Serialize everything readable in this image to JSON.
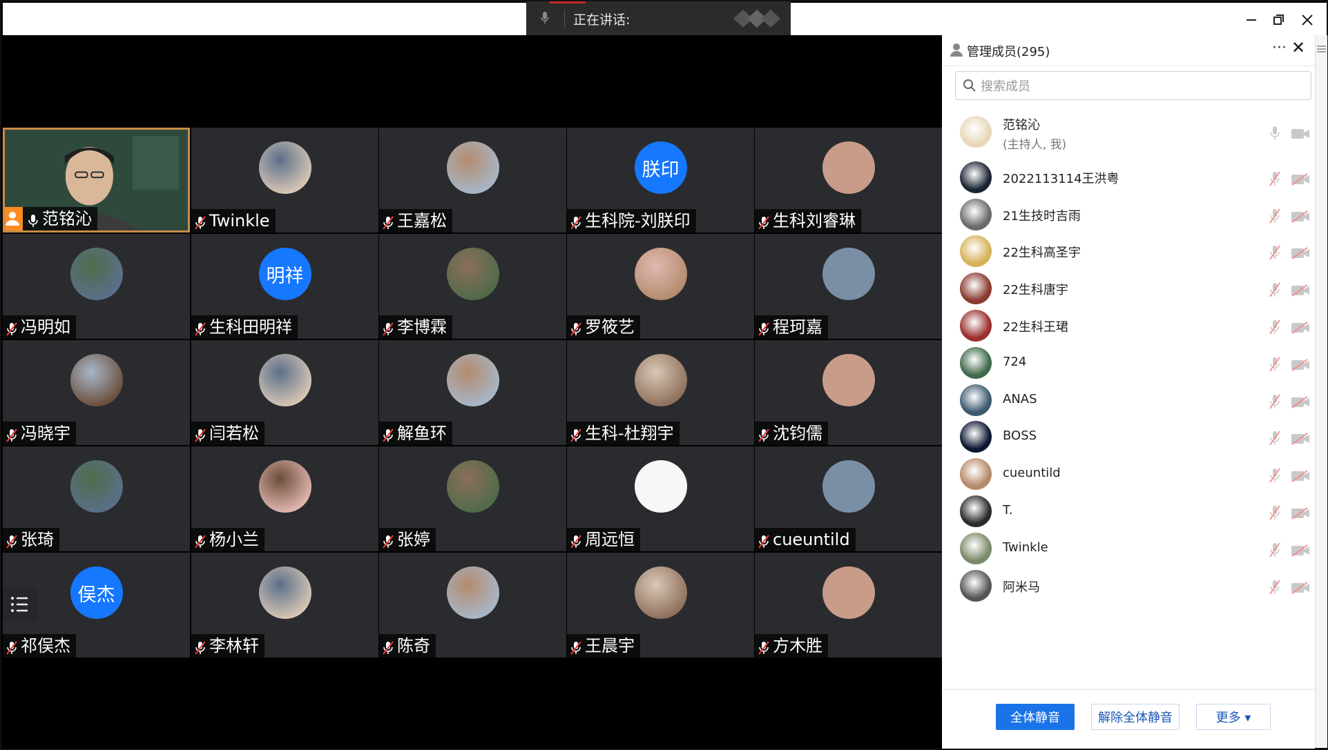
{
  "speaking": {
    "label": "正在讲话:"
  },
  "tiles": [
    {
      "name": "范铭沁",
      "host": true
    },
    {
      "name": "Twinkle",
      "avatar": "photo"
    },
    {
      "name": "王嘉松",
      "avatar": "photo"
    },
    {
      "name": "生科院-刘朕印",
      "avatar_text": "朕印"
    },
    {
      "name": "生科刘睿琳",
      "avatar": "photo"
    },
    {
      "name": "冯明如",
      "avatar": "photo"
    },
    {
      "name": "生科田明祥",
      "avatar_text": "明祥"
    },
    {
      "name": "李博霖",
      "avatar": "photo"
    },
    {
      "name": "罗筱艺",
      "avatar": "photo"
    },
    {
      "name": "程珂嘉",
      "avatar": "photo"
    },
    {
      "name": "冯晓宇",
      "avatar": "photo"
    },
    {
      "name": "闫若松",
      "avatar": "photo"
    },
    {
      "name": "解鱼环",
      "avatar": "photo"
    },
    {
      "name": "生科-杜翔宇",
      "avatar": "photo"
    },
    {
      "name": "沈钧儒",
      "avatar": "photo"
    },
    {
      "name": "张琦",
      "avatar": "photo"
    },
    {
      "name": "杨小兰",
      "avatar": "photo"
    },
    {
      "name": "张婷",
      "avatar": "photo"
    },
    {
      "name": "周远恒",
      "avatar": "white"
    },
    {
      "name": "cueuntild",
      "avatar": "photo"
    },
    {
      "name": "祁俣杰",
      "avatar_text": "俣杰"
    },
    {
      "name": "李林轩",
      "avatar": "photo"
    },
    {
      "name": "陈奇",
      "avatar": "photo"
    },
    {
      "name": "王晨宇",
      "avatar": "photo"
    },
    {
      "name": "方木胜",
      "avatar": "photo"
    }
  ],
  "panel": {
    "title": "管理成员(295)",
    "more_icon": "···",
    "close_icon": "✕",
    "search_placeholder": "搜索成员",
    "members": [
      {
        "name": "范铭沁",
        "sub": "(主持人, 我)",
        "muted": false
      },
      {
        "name": "2022113114王洪粤",
        "muted": true
      },
      {
        "name": "21生技时吉雨",
        "muted": true
      },
      {
        "name": "22生科高圣宇",
        "muted": true
      },
      {
        "name": "22生科唐宇",
        "muted": true
      },
      {
        "name": "22生科王珺",
        "muted": true
      },
      {
        "name": "724",
        "muted": true
      },
      {
        "name": "ANAS",
        "muted": true
      },
      {
        "name": "BOSS",
        "muted": true
      },
      {
        "name": "cueuntild",
        "muted": true
      },
      {
        "name": "T.",
        "muted": true
      },
      {
        "name": "Twinkle",
        "muted": true
      },
      {
        "name": "阿米马",
        "muted": true
      }
    ],
    "buttons": {
      "mute_all": "全体静音",
      "unmute_all": "解除全体静音",
      "more": "更多 ▾"
    }
  },
  "colors": {
    "accent": "#1a73e8",
    "tile_bg": "#2a2b2e",
    "avatar_text_bg": "#1677ff",
    "host_badge": "#ff8a1f"
  }
}
